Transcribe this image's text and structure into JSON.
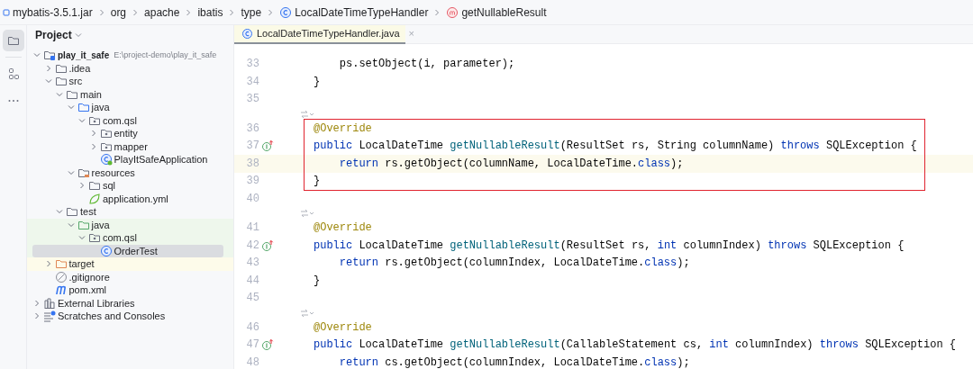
{
  "breadcrumb": [
    {
      "label": "mybatis-3.5.1.jar",
      "kind": "jar"
    },
    {
      "label": "org",
      "kind": "package"
    },
    {
      "label": "apache",
      "kind": "package"
    },
    {
      "label": "ibatis",
      "kind": "package"
    },
    {
      "label": "type",
      "kind": "package"
    },
    {
      "label": "LocalDateTimeTypeHandler",
      "kind": "class"
    },
    {
      "label": "getNullableResult",
      "kind": "method"
    }
  ],
  "tool_strip": [
    {
      "kind": "project",
      "selected": true
    },
    {
      "kind": "structure",
      "selected": false
    },
    {
      "kind": "more",
      "selected": false
    }
  ],
  "project_panel": {
    "title": "Project",
    "tree": [
      {
        "label": "play_it_safe",
        "path": "E:\\project-demo\\play_it_safe",
        "kind": "module",
        "expanded": true,
        "selected": false,
        "children": [
          {
            "label": ".idea",
            "kind": "folder",
            "expanded": false,
            "selected": false
          },
          {
            "label": "src",
            "kind": "folder",
            "expanded": true,
            "selected": false,
            "children": [
              {
                "label": "main",
                "kind": "folder",
                "expanded": true,
                "selected": false,
                "children": [
                  {
                    "label": "java",
                    "kind": "source-folder",
                    "expanded": true,
                    "selected": false,
                    "children": [
                      {
                        "label": "com.qsl",
                        "kind": "package",
                        "expanded": true,
                        "selected": false,
                        "children": [
                          {
                            "label": "entity",
                            "kind": "package",
                            "expanded": false,
                            "selected": false
                          },
                          {
                            "label": "mapper",
                            "kind": "package",
                            "expanded": false,
                            "selected": false
                          },
                          {
                            "label": "PlayItSafeApplication",
                            "kind": "spring-class",
                            "selected": false
                          }
                        ]
                      }
                    ]
                  },
                  {
                    "label": "resources",
                    "kind": "resource-folder",
                    "expanded": true,
                    "selected": false,
                    "children": [
                      {
                        "label": "sql",
                        "kind": "folder",
                        "expanded": false,
                        "selected": false
                      },
                      {
                        "label": "application.yml",
                        "kind": "config",
                        "selected": false
                      }
                    ]
                  }
                ]
              },
              {
                "label": "test",
                "kind": "folder",
                "expanded": true,
                "selected": false,
                "children": [
                  {
                    "label": "java",
                    "kind": "test-folder",
                    "test_source": true,
                    "expanded": true,
                    "selected": false,
                    "children": [
                      {
                        "label": "com.qsl",
                        "kind": "package",
                        "test_source": true,
                        "expanded": true,
                        "selected": false,
                        "children": [
                          {
                            "label": "OrderTest",
                            "kind": "class",
                            "test_source": true,
                            "selected": true
                          }
                        ]
                      }
                    ]
                  }
                ]
              }
            ]
          },
          {
            "label": "target",
            "kind": "excluded-folder",
            "excluded": true,
            "expanded": false,
            "selected": false
          },
          {
            "label": ".gitignore",
            "kind": "ignore",
            "selected": false
          },
          {
            "label": "pom.xml",
            "kind": "maven",
            "selected": false
          }
        ]
      },
      {
        "label": "External Libraries",
        "kind": "libraries",
        "expanded": false,
        "selected": false
      },
      {
        "label": "Scratches and Consoles",
        "kind": "scratches",
        "expanded": false,
        "selected": false
      }
    ]
  },
  "editor": {
    "tabs": [
      {
        "label": "LocalDateTimeTypeHandler.java",
        "close": "×",
        "selected": true
      }
    ],
    "lines": [
      {
        "number": "33",
        "tokens": [
          {
            "text": "    ps.setObject(i, parameter);",
            "kind": "plain"
          }
        ]
      },
      {
        "number": "34",
        "tokens": [
          {
            "text": "}",
            "kind": "plain"
          }
        ]
      },
      {
        "number": "35"
      },
      {
        "number": "36",
        "hint": true,
        "boxed": true,
        "tokens": [
          {
            "text": "@Override",
            "kind": "annotation"
          }
        ]
      },
      {
        "number": "37",
        "implements": true,
        "boxed": true,
        "tokens": [
          {
            "text": "public",
            "kind": "keyword"
          },
          {
            "text": " LocalDateTime ",
            "kind": "plain"
          },
          {
            "text": "getNullableResult",
            "kind": "method"
          },
          {
            "text": "(ResultSet rs, String columnName) ",
            "kind": "plain"
          },
          {
            "text": "throws",
            "kind": "keyword"
          },
          {
            "text": " SQLException {",
            "kind": "plain"
          }
        ]
      },
      {
        "number": "38",
        "current": true,
        "boxed": true,
        "tokens": [
          {
            "text": "    return",
            "kind": "keyword"
          },
          {
            "text": " rs.getObject(columnName, LocalDateTime.",
            "kind": "plain"
          },
          {
            "text": "class",
            "kind": "keyword"
          },
          {
            "text": ");",
            "kind": "plain"
          }
        ]
      },
      {
        "number": "39",
        "boxed": true,
        "tokens": [
          {
            "text": "}",
            "kind": "plain"
          }
        ]
      },
      {
        "number": "40"
      },
      {
        "number": "41",
        "hint": true,
        "tokens": [
          {
            "text": "@Override",
            "kind": "annotation"
          }
        ]
      },
      {
        "number": "42",
        "implements": true,
        "tokens": [
          {
            "text": "public",
            "kind": "keyword"
          },
          {
            "text": " LocalDateTime ",
            "kind": "plain"
          },
          {
            "text": "getNullableResult",
            "kind": "method"
          },
          {
            "text": "(ResultSet rs, ",
            "kind": "plain"
          },
          {
            "text": "int",
            "kind": "keyword"
          },
          {
            "text": " columnIndex) ",
            "kind": "plain"
          },
          {
            "text": "throws",
            "kind": "keyword"
          },
          {
            "text": " SQLException {",
            "kind": "plain"
          }
        ]
      },
      {
        "number": "43",
        "tokens": [
          {
            "text": "    return",
            "kind": "keyword"
          },
          {
            "text": " rs.getObject(columnIndex, LocalDateTime.",
            "kind": "plain"
          },
          {
            "text": "class",
            "kind": "keyword"
          },
          {
            "text": ");",
            "kind": "plain"
          }
        ]
      },
      {
        "number": "44",
        "tokens": [
          {
            "text": "}",
            "kind": "plain"
          }
        ]
      },
      {
        "number": "45"
      },
      {
        "number": "46",
        "hint": true,
        "tokens": [
          {
            "text": "@Override",
            "kind": "annotation"
          }
        ]
      },
      {
        "number": "47",
        "implements": true,
        "tokens": [
          {
            "text": "public",
            "kind": "keyword"
          },
          {
            "text": " LocalDateTime ",
            "kind": "plain"
          },
          {
            "text": "getNullableResult",
            "kind": "method"
          },
          {
            "text": "(CallableStatement cs, ",
            "kind": "plain"
          },
          {
            "text": "int",
            "kind": "keyword"
          },
          {
            "text": " columnIndex) ",
            "kind": "plain"
          },
          {
            "text": "throws",
            "kind": "keyword"
          },
          {
            "text": " SQLException {",
            "kind": "plain"
          }
        ]
      },
      {
        "number": "48",
        "tokens": [
          {
            "text": "    return",
            "kind": "keyword"
          },
          {
            "text": " cs.getObject(columnIndex, LocalDateTime.",
            "kind": "plain"
          },
          {
            "text": "class",
            "kind": "keyword"
          },
          {
            "text": ");",
            "kind": "plain"
          }
        ]
      }
    ]
  }
}
